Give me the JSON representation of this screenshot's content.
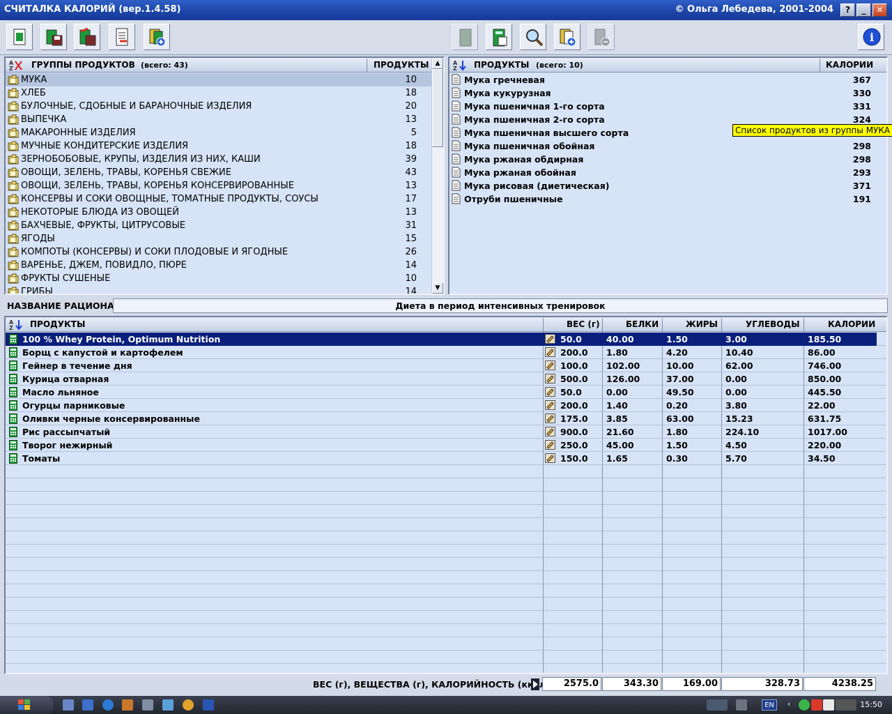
{
  "window": {
    "title": "СЧИТАЛКА КАЛОРИЙ  (вер.1.4.58)",
    "copyright": "© Ольга Лебедева, 2001-2004",
    "buttons": {
      "help": "?",
      "minimize": "_",
      "close": "✕"
    }
  },
  "groups_panel": {
    "header_title": "ГРУППЫ ПРОДУКТОВ",
    "header_count": "(всего: 43)",
    "header_products": "ПРОДУКТЫ",
    "items": [
      {
        "name": "МУКА",
        "count": "10",
        "selected": true
      },
      {
        "name": "ХЛЕБ",
        "count": "18"
      },
      {
        "name": "БУЛОЧНЫЕ, СДОБНЫЕ И БАРАНОЧНЫЕ ИЗДЕЛИЯ",
        "count": "20"
      },
      {
        "name": "ВЫПЕЧКА",
        "count": "13"
      },
      {
        "name": "МАКАРОННЫЕ ИЗДЕЛИЯ",
        "count": "5"
      },
      {
        "name": "МУЧНЫЕ КОНДИТЕРСКИЕ ИЗДЕЛИЯ",
        "count": "18"
      },
      {
        "name": "ЗЕРНОБОБОВЫЕ, КРУПЫ, ИЗДЕЛИЯ ИЗ НИХ, КАШИ",
        "count": "39"
      },
      {
        "name": "ОВОЩИ, ЗЕЛЕНЬ, ТРАВЫ, КОРЕНЬЯ СВЕЖИЕ",
        "count": "43"
      },
      {
        "name": "ОВОЩИ, ЗЕЛЕНЬ, ТРАВЫ, КОРЕНЬЯ КОНСЕРВИРОВАННЫЕ",
        "count": "13"
      },
      {
        "name": "КОНСЕРВЫ И СОКИ ОВОЩНЫЕ, ТОМАТНЫЕ ПРОДУКТЫ, СОУСЫ",
        "count": "17"
      },
      {
        "name": "НЕКОТОРЫЕ БЛЮДА ИЗ ОВОЩЕЙ",
        "count": "13"
      },
      {
        "name": "БАХЧЕВЫЕ, ФРУКТЫ, ЦИТРУСОВЫЕ",
        "count": "31"
      },
      {
        "name": "ЯГОДЫ",
        "count": "15"
      },
      {
        "name": "КОМПОТЫ (КОНСЕРВЫ) И СОКИ ПЛОДОВЫЕ И ЯГОДНЫЕ",
        "count": "26"
      },
      {
        "name": "ВАРЕНЬЕ, ДЖЕМ, ПОВИДЛО, ПЮРЕ",
        "count": "14"
      },
      {
        "name": "ФРУКТЫ СУШЕНЫЕ",
        "count": "10"
      },
      {
        "name": "ГРИБЫ",
        "count": "14"
      }
    ]
  },
  "products_panel": {
    "header_title": "ПРОДУКТЫ",
    "header_count": "(всего: 10)",
    "header_calories": "КАЛОРИИ",
    "tooltip": "Список продуктов из группы МУКА",
    "items": [
      {
        "name": "Мука гречневая",
        "calories": "367"
      },
      {
        "name": "Мука кукурузная",
        "calories": "330"
      },
      {
        "name": "Мука пшеничная 1-го сорта",
        "calories": "331"
      },
      {
        "name": "Мука пшеничная 2-го сорта",
        "calories": "324"
      },
      {
        "name": "Мука пшеничная высшего сорта",
        "calories": ""
      },
      {
        "name": "Мука пшеничная обойная",
        "calories": "298"
      },
      {
        "name": "Мука ржаная обдирная",
        "calories": "298"
      },
      {
        "name": "Мука ржаная обойная",
        "calories": "293"
      },
      {
        "name": "Мука рисовая (диетическая)",
        "calories": "371"
      },
      {
        "name": "Отруби пшеничные",
        "calories": "191"
      }
    ]
  },
  "ration": {
    "label": "НАЗВАНИЕ РАЦИОНА:",
    "value": "Диета в период интенсивных тренировок"
  },
  "diet_table": {
    "headers": {
      "product": "ПРОДУКТЫ",
      "weight": "ВЕС (г)",
      "protein": "БЕЛКИ",
      "fat": "ЖИРЫ",
      "carbs": "УГЛЕВОДЫ",
      "calories": "КАЛОРИИ"
    },
    "rows": [
      {
        "name": "100 % Whey Protein, Optimum Nutrition",
        "weight": "50.0",
        "protein": "40.00",
        "fat": "1.50",
        "carbs": "3.00",
        "calories": "185.50",
        "selected": true
      },
      {
        "name": "Борщ с капустой и картофелем",
        "weight": "200.0",
        "protein": "1.80",
        "fat": "4.20",
        "carbs": "10.40",
        "calories": "86.00"
      },
      {
        "name": "Гейнер в течение дня",
        "weight": "100.0",
        "protein": "102.00",
        "fat": "10.00",
        "carbs": "62.00",
        "calories": "746.00"
      },
      {
        "name": "Курица отварная",
        "weight": "500.0",
        "protein": "126.00",
        "fat": "37.00",
        "carbs": "0.00",
        "calories": "850.00"
      },
      {
        "name": "Масло льняное",
        "weight": "50.0",
        "protein": "0.00",
        "fat": "49.50",
        "carbs": "0.00",
        "calories": "445.50"
      },
      {
        "name": "Огурцы парниковые",
        "weight": "200.0",
        "protein": "1.40",
        "fat": "0.20",
        "carbs": "3.80",
        "calories": "22.00"
      },
      {
        "name": "Оливки черные консервированные",
        "weight": "175.0",
        "protein": "3.85",
        "fat": "63.00",
        "carbs": "15.23",
        "calories": "631.75"
      },
      {
        "name": "Рис рассыпчатый",
        "weight": "900.0",
        "protein": "21.60",
        "fat": "1.80",
        "carbs": "224.10",
        "calories": "1017.00"
      },
      {
        "name": "Творог нежирный",
        "weight": "250.0",
        "protein": "45.00",
        "fat": "1.50",
        "carbs": "4.50",
        "calories": "220.00"
      },
      {
        "name": "Томаты",
        "weight": "150.0",
        "protein": "1.65",
        "fat": "0.30",
        "carbs": "5.70",
        "calories": "34.50"
      }
    ]
  },
  "totals": {
    "label": "ВЕС (г), ВЕЩЕСТВА (г), КАЛОРИЙНОСТЬ (ккал)",
    "weight": "2575.0",
    "protein": "343.30",
    "fat": "169.00",
    "carbs": "328.73",
    "calories": "4238.25"
  },
  "taskbar": {
    "lang": "EN",
    "clock": "15:50"
  }
}
